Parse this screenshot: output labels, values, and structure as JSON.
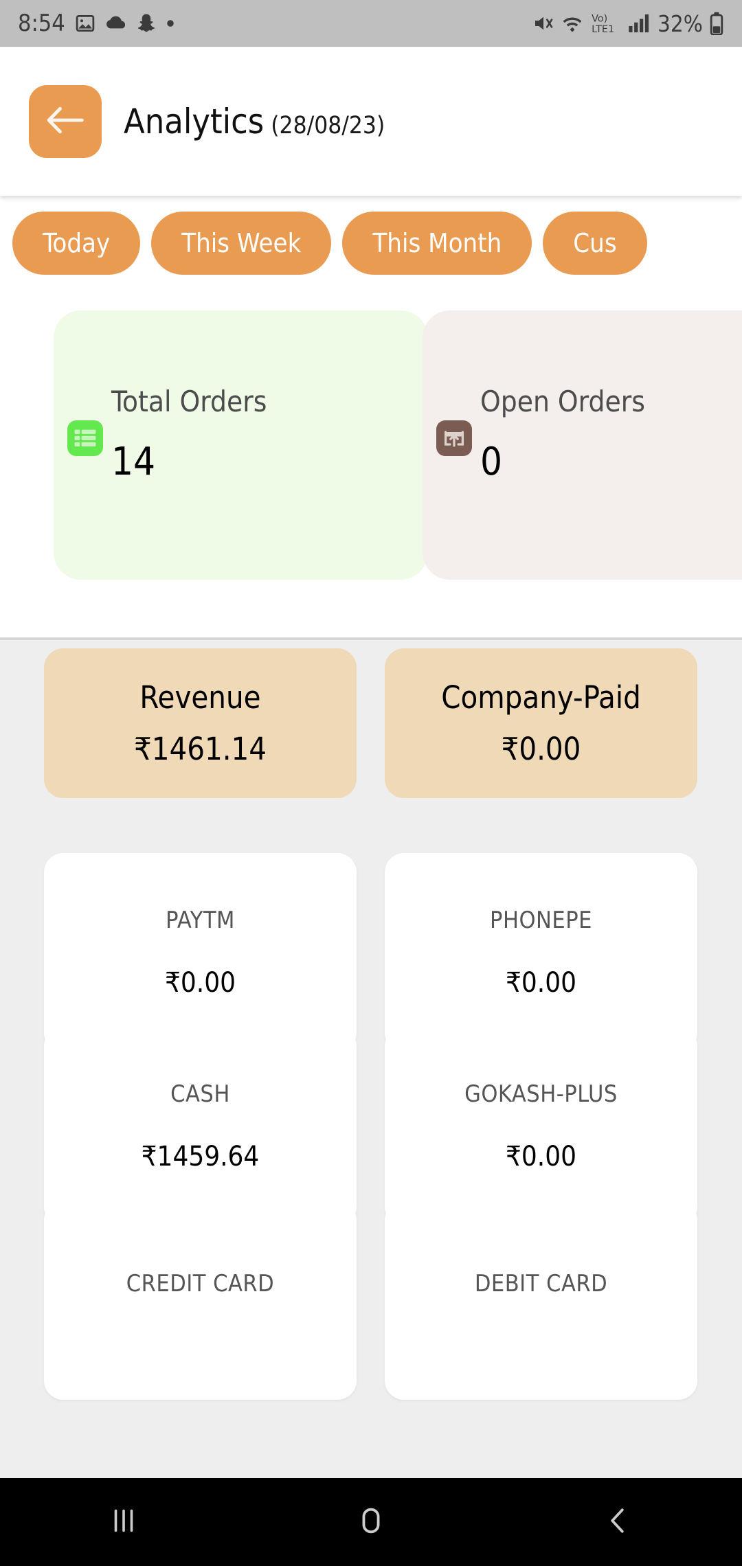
{
  "status_bar": {
    "time": "8:54",
    "battery_percent": "32%",
    "left_icons": [
      "photo-icon",
      "cloud-icon",
      "snapchat-icon",
      "dot-icon"
    ],
    "right_icons": [
      "mute-icon",
      "wifi-icon",
      "volte-icon",
      "signal-icon",
      "battery-icon"
    ],
    "network_label": "Vo)",
    "network_sub": "LTE1",
    "background": "#bfbfbf"
  },
  "app_bar": {
    "back_label": "back-arrow",
    "title": "Analytics",
    "date": "(28/08/23)",
    "accent": "#e89b51"
  },
  "tabs": [
    {
      "label": "Today"
    },
    {
      "label": "This Week"
    },
    {
      "label": "This Month"
    },
    {
      "label": "Cus"
    }
  ],
  "summary": [
    {
      "label": "Total Orders",
      "value": "14",
      "icon": "table-list-icon",
      "card_color": "#effbe7",
      "icon_color": "#63e84f"
    },
    {
      "label": "Open Orders",
      "value": "0",
      "icon": "open-box-arrow-icon",
      "card_color": "#f4efec",
      "icon_color": "#7a5c52"
    }
  ],
  "payments": {
    "highlight_color": "#f0d9b7",
    "rows": [
      [
        {
          "label": "Revenue",
          "value": "₹1461.14",
          "style": "highlight"
        },
        {
          "label": "Company-Paid",
          "value": "₹0.00",
          "style": "highlight"
        }
      ],
      [
        {
          "label": "PAYTM",
          "value": "₹0.00",
          "style": "plain"
        },
        {
          "label": "PHONEPE",
          "value": "₹0.00",
          "style": "plain"
        }
      ],
      [
        {
          "label": "CASH",
          "value": "₹1459.64",
          "style": "plain"
        },
        {
          "label": "GOKASH-PLUS",
          "value": "₹0.00",
          "style": "plain"
        }
      ],
      [
        {
          "label": "CREDIT CARD",
          "value": "",
          "style": "plain"
        },
        {
          "label": "DEBIT CARD",
          "value": "",
          "style": "plain"
        }
      ]
    ]
  },
  "nav_bar": {
    "recents": "recents-icon",
    "home": "home-icon",
    "back": "back-icon"
  }
}
